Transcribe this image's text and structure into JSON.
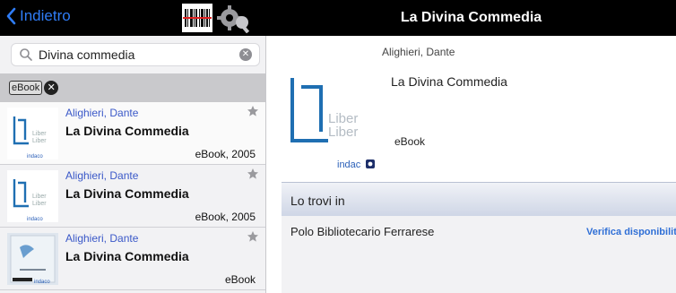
{
  "nav": {
    "back_label": "Indietro",
    "barcode_icon": "barcode-icon",
    "settings_icon": "gear-icon",
    "detail_title": "La Divina Commedia"
  },
  "search": {
    "value": "Divina commedia",
    "icon": "search-icon",
    "clear_icon": "clear-icon"
  },
  "filter": {
    "chip_label": "eBook",
    "remove_icon": "close-icon"
  },
  "results": [
    {
      "author": "Alighieri, Dante",
      "title": "La Divina Commedia",
      "meta": "eBook, 2005",
      "thumb": "liberliber"
    },
    {
      "author": "Alighieri, Dante",
      "title": "La Divina Commedia",
      "meta": "eBook, 2005",
      "thumb": "liberliber"
    },
    {
      "author": "Alighieri, Dante",
      "title": "La Divina Commedia",
      "meta": "eBook",
      "thumb": "cover"
    }
  ],
  "detail": {
    "author": "Alighieri, Dante",
    "title": "La Divina Commedia",
    "format": "eBook",
    "publisher_logo": "Liber Liber",
    "source_logo": "indaco",
    "availability_header": "Lo trovi in",
    "library": "Polo Bibliotecario Ferrarese",
    "verify_label": "Verifica disponibilità"
  },
  "colors": {
    "accent": "#2f7cf6",
    "author_link": "#3a58c8",
    "topbar": "#000000",
    "liber_blue": "#1f6fb2"
  }
}
